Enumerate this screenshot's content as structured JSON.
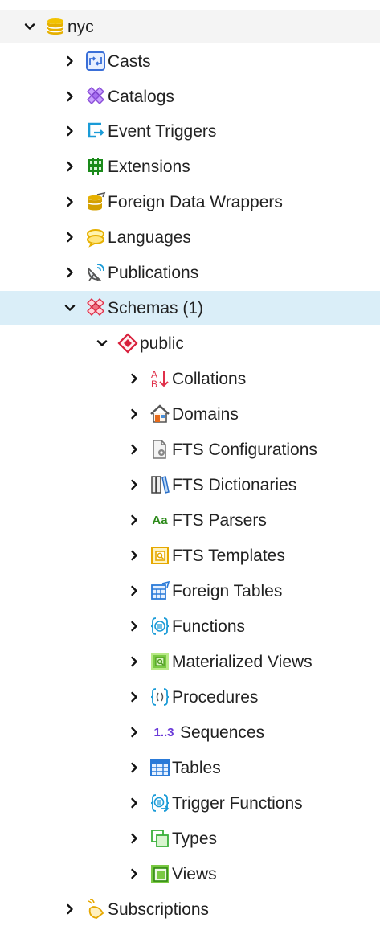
{
  "colors": {
    "selected_row": "#daeef8",
    "top_row": "#f4f4f4",
    "chevron": "#111111"
  },
  "tree": {
    "root": {
      "label": "nyc",
      "icon": "database-icon",
      "expanded": true
    },
    "children": [
      {
        "label": "Casts",
        "icon": "casts-icon"
      },
      {
        "label": "Catalogs",
        "icon": "catalogs-icon"
      },
      {
        "label": "Event Triggers",
        "icon": "event-triggers-icon"
      },
      {
        "label": "Extensions",
        "icon": "extensions-icon"
      },
      {
        "label": "Foreign Data Wrappers",
        "icon": "foreign-data-wrappers-icon"
      },
      {
        "label": "Languages",
        "icon": "languages-icon"
      },
      {
        "label": "Publications",
        "icon": "publications-icon"
      },
      {
        "label": "Schemas (1)",
        "icon": "schemas-icon",
        "expanded": true,
        "selected": true
      }
    ],
    "schema": {
      "label": "public",
      "icon": "schema-icon",
      "expanded": true
    },
    "schema_items": [
      {
        "label": "Collations",
        "icon": "collations-icon"
      },
      {
        "label": "Domains",
        "icon": "domains-icon"
      },
      {
        "label": "FTS Configurations",
        "icon": "fts-configurations-icon"
      },
      {
        "label": "FTS Dictionaries",
        "icon": "fts-dictionaries-icon"
      },
      {
        "label": "FTS Parsers",
        "icon": "fts-parsers-icon",
        "icon_text": "Aa"
      },
      {
        "label": "FTS Templates",
        "icon": "fts-templates-icon"
      },
      {
        "label": "Foreign Tables",
        "icon": "foreign-tables-icon"
      },
      {
        "label": "Functions",
        "icon": "functions-icon"
      },
      {
        "label": "Materialized Views",
        "icon": "materialized-views-icon"
      },
      {
        "label": "Procedures",
        "icon": "procedures-icon"
      },
      {
        "label": "Sequences",
        "icon": "sequences-icon",
        "icon_text": "1..3"
      },
      {
        "label": "Tables",
        "icon": "tables-icon"
      },
      {
        "label": "Trigger Functions",
        "icon": "trigger-functions-icon"
      },
      {
        "label": "Types",
        "icon": "types-icon"
      },
      {
        "label": "Views",
        "icon": "views-icon"
      }
    ],
    "after": [
      {
        "label": "Subscriptions",
        "icon": "subscriptions-icon"
      }
    ]
  }
}
